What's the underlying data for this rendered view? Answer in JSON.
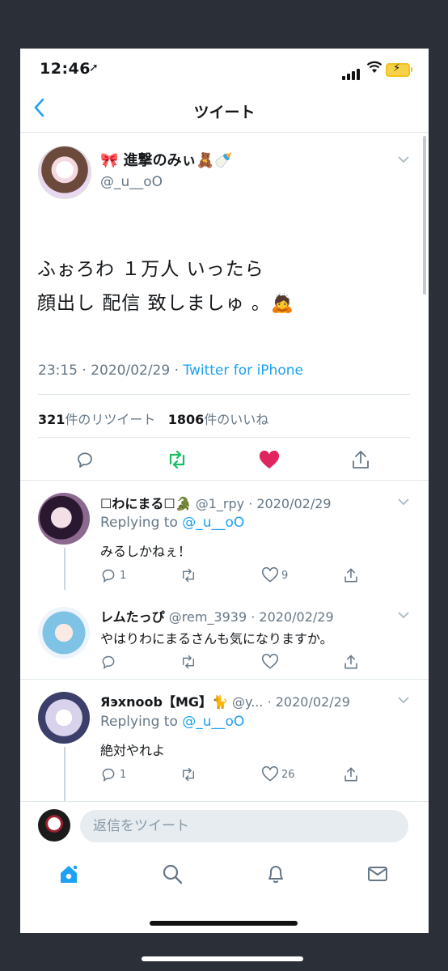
{
  "status": {
    "time": "12:46"
  },
  "nav": {
    "title": "ツイート"
  },
  "tweet": {
    "author_name": "🎀 進撃のみぃ🧸🍼",
    "author_handle": "@_u__oO",
    "text_line1": "ふぉろわ １万人 いったら",
    "text_line2": "顔出し 配信 致しましゅ 。🙇",
    "time": "23:15 · 2020/02/29 · ",
    "source": "Twitter for iPhone",
    "retweet_count": "321",
    "retweet_label": "件のリツイート",
    "like_count": "1806",
    "like_label": "件のいいね"
  },
  "replies": [
    {
      "name": "☐わにまる☐🐊",
      "handle": "@1_rpy",
      "date": "· 2020/02/29",
      "replying_label": "Replying to ",
      "replying_to": "@_u__oO",
      "text": "みるしかねぇ！",
      "reply_count": "1",
      "like_count": "9"
    },
    {
      "name": "レムたっぴ",
      "handle": "@rem_3939",
      "date": "· 2020/02/29",
      "text": "やはりわにまるさんも気になりますか。",
      "reply_count": "",
      "like_count": ""
    },
    {
      "name": "Яэхnoob【MG】🐈",
      "handle": "@y...",
      "date": "· 2020/02/29",
      "replying_label": "Replying to ",
      "replying_to": "@_u__oO",
      "text": "絶対やれよ",
      "reply_count": "1",
      "like_count": "26"
    }
  ],
  "composer": {
    "placeholder": "返信をツイート"
  },
  "colors": {
    "accent": "#1da1f2",
    "retweet": "#17bf63",
    "like": "#e0245e"
  }
}
